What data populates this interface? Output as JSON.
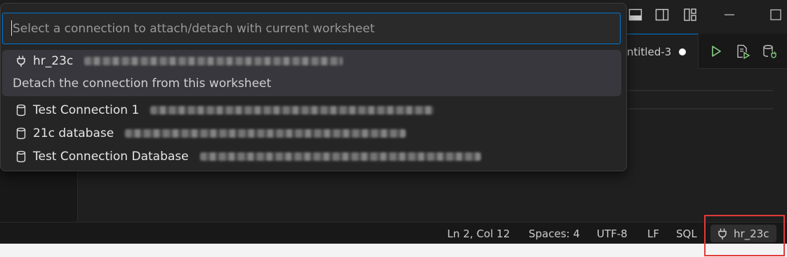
{
  "quickpick": {
    "placeholder": "Select a connection to attach/detach with current worksheet",
    "items": [
      {
        "icon": "plug-icon",
        "label": "hr_23c",
        "description": "Detach the connection from this worksheet",
        "active": true
      },
      {
        "icon": "database-icon",
        "label": "Test Connection 1"
      },
      {
        "icon": "database-icon",
        "label": "21c database"
      },
      {
        "icon": "database-icon",
        "label": "Test Connection Database"
      }
    ]
  },
  "tab": {
    "label": "ntitled-3",
    "modified": true
  },
  "titlebar_icons": [
    "toggle-panel-icon",
    "toggle-secondary-sidebar-icon",
    "customize-layout-icon",
    "minimize-icon",
    "maximize-icon"
  ],
  "editor_actions": [
    "run-icon",
    "run-script-icon",
    "manage-connection-icon"
  ],
  "statusbar": {
    "position": "Ln 2, Col 12",
    "indent": "Spaces: 4",
    "encoding": "UTF-8",
    "eol": "LF",
    "language": "SQL",
    "connection": "hr_23c"
  },
  "colors": {
    "accent": "#0078d4",
    "highlight": "#e23a3a",
    "run_green": "#89d185"
  }
}
